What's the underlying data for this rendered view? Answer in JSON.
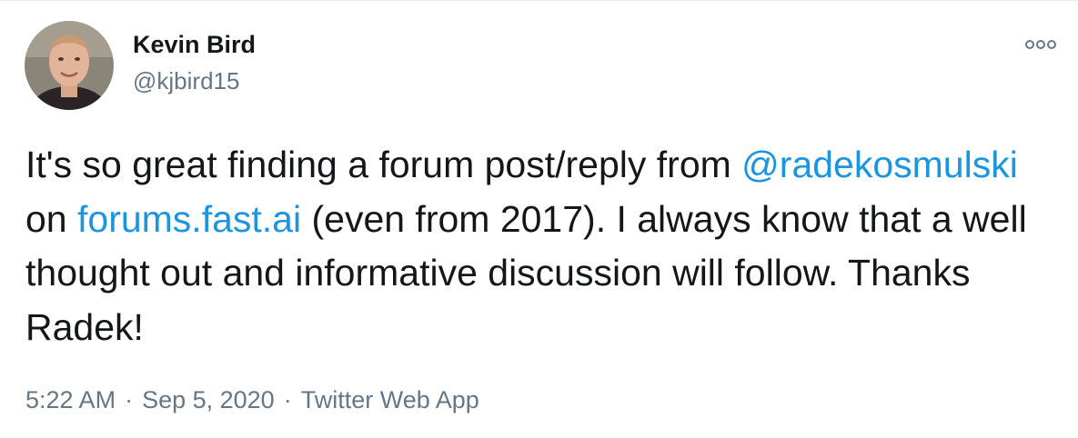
{
  "author": {
    "display_name": "Kevin Bird",
    "handle": "@kjbird15"
  },
  "tweet": {
    "text_1": "It's so great finding a forum post/reply from ",
    "mention": "@radekosmulski",
    "text_2": " on ",
    "link": "forums.fast.ai",
    "text_3": " (even from 2017).  I always know that a well thought out and informative discussion will follow.  Thanks Radek!"
  },
  "meta": {
    "time": "5:22 AM",
    "separator": "·",
    "date": "Sep 5, 2020",
    "source": "Twitter Web App"
  },
  "icons": {
    "more": "more-options-icon",
    "avatar": "profile-photo"
  },
  "colors": {
    "link": "#1b95e0",
    "secondary_text": "#657786",
    "primary_text": "#14171a"
  }
}
